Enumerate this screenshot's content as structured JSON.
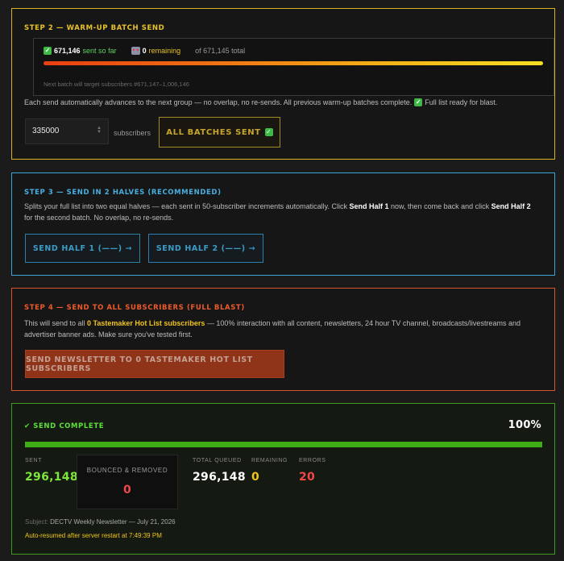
{
  "step2": {
    "title": "STEP 2 — WARM-UP BATCH SEND",
    "sent_count": "671,146",
    "sent_label": "sent so far",
    "remaining_count": "0",
    "remaining_label": "remaining",
    "total_label": "of 671,145 total",
    "progress_fraction": 1.0,
    "next_batch": "Next batch will target subscribers #671,147–1,006,146",
    "description_a": "Each send automatically advances to the next group — no overlap, no re-sends. All previous warm-up batches complete.",
    "description_b": "Full list ready for blast.",
    "batch_size_value": "335000",
    "subscribers_label": "subscribers",
    "all_sent_label": "ALL BATCHES SENT",
    "check_icon_glyph": "✓"
  },
  "step3": {
    "title": "STEP 3 — SEND IN 2 HALVES (RECOMMENDED)",
    "desc_1": "Splits your full list into two equal halves — each sent in 50-subscriber increments automatically. Click ",
    "desc_bold_1": "Send Half 1",
    "desc_2": " now, then come back and click ",
    "desc_bold_2": "Send Half 2",
    "desc_3": " for the second batch. No overlap, no re-sends.",
    "half1_label": "SEND HALF 1 (——) →",
    "half2_label": "SEND HALF 2 (——) →"
  },
  "step4": {
    "title": "STEP 4 — SEND TO ALL SUBSCRIBERS (FULL BLAST)",
    "desc_1": "This will send to all ",
    "desc_highlight": "0 Tastemaker Hot List subscribers",
    "desc_2": " — 100% interaction with all content, newsletters, 24 hour TV channel, broadcasts/livestreams and advertiser banner ads. Make sure you've tested first.",
    "button_label": "SEND NEWSLETTER TO 0 TASTEMAKER HOT LIST SUBSCRIBERS"
  },
  "complete": {
    "title": "✔ SEND COMPLETE",
    "percent": "100%",
    "progress_fraction": 1.0,
    "sent_label": "SENT",
    "sent_value": "296,148",
    "bounced_label": "BOUNCED & REMOVED",
    "bounced_value": "0",
    "queued_label": "TOTAL QUEUED",
    "queued_value": "296,148",
    "remaining_label": "REMAINING",
    "remaining_value": "0",
    "errors_label": "ERRORS",
    "errors_value": "20",
    "subject_label": "Subject:",
    "subject_value": "DECTV Weekly Newsletter — July 21, 2026",
    "autoresume": "Auto-resumed after server restart at 7:49:39 PM"
  },
  "colors": {
    "step2_accent": "#d8b221",
    "step3_accent": "#3aa4d8",
    "step4_accent": "#d8562a",
    "complete_accent": "#3f9a1c",
    "sent_green": "#7ee53a",
    "remaining_yellow": "#f0c419",
    "error_red": "#f04848"
  }
}
